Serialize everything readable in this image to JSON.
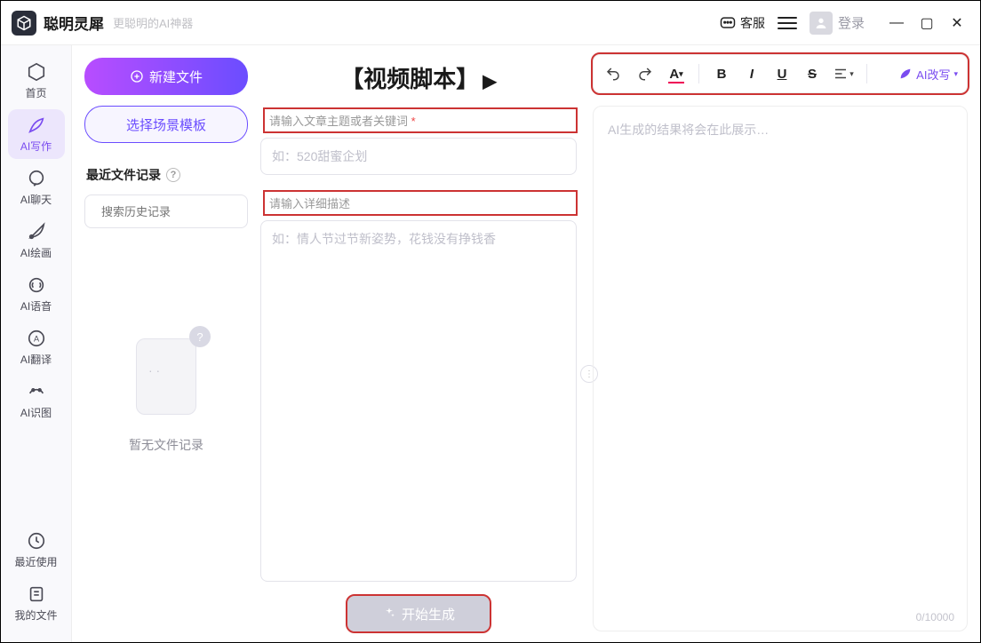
{
  "titlebar": {
    "app_name": "聪明灵犀",
    "tagline": "更聪明的AI神器",
    "support": "客服",
    "login": "登录"
  },
  "sidebar": {
    "items": [
      {
        "label": "首页"
      },
      {
        "label": "AI写作"
      },
      {
        "label": "AI聊天"
      },
      {
        "label": "AI绘画"
      },
      {
        "label": "AI语音"
      },
      {
        "label": "AI翻译"
      },
      {
        "label": "AI识图"
      }
    ],
    "lower": [
      {
        "label": "最近使用"
      },
      {
        "label": "我的文件"
      }
    ]
  },
  "filecol": {
    "new_btn": "新建文件",
    "template_btn": "选择场景模板",
    "recent_title": "最近文件记录",
    "search_placeholder": "搜索历史记录",
    "empty_text": "暂无文件记录"
  },
  "mid": {
    "title": "【视频脚本】",
    "label_topic": "请输入文章主题或者关键词",
    "topic_placeholder": "如：520甜蜜企划",
    "label_detail": "请输入详细描述",
    "detail_placeholder": "如：情人节过节新姿势，花钱没有挣钱香",
    "generate": "开始生成"
  },
  "right": {
    "placeholder": "AI生成的结果将会在此展示…",
    "counter": "0/10000",
    "rewrite": "AI改写",
    "tb": {
      "bold": "B",
      "italic": "I",
      "underline": "U",
      "strike": "S",
      "font": "A"
    }
  }
}
